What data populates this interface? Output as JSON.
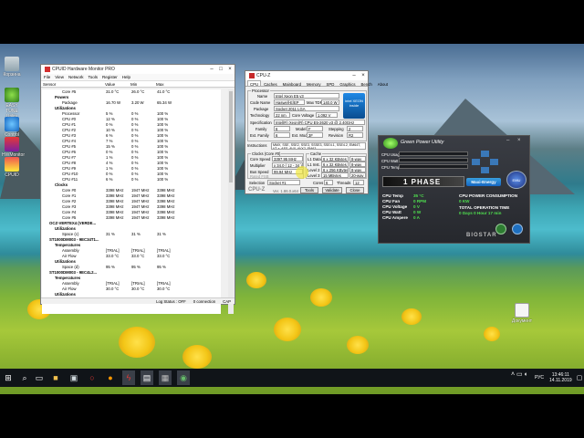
{
  "colors": {
    "accent_green": "#4fe04f",
    "taskbar": "#101418",
    "gpu_panel": "#2d3035",
    "intel_blue": "#0a6ab5"
  },
  "desktop_icons": [
    {
      "name": "desktop-icon-recycle",
      "label": "Корзина",
      "icon": "recycle-bin-icon"
    },
    {
      "name": "desktop-icon-easy-tune",
      "label": "EASY TUNE Utility",
      "icon": "easy-tune-icon"
    },
    {
      "name": "desktop-icon-control",
      "label": "Control Panel",
      "icon": "control-panel-icon"
    },
    {
      "name": "desktop-icon-hwmon",
      "label": "HWMonitor",
      "icon": "hwmonitor-icon"
    },
    {
      "name": "desktop-icon-cpuz",
      "label": "CPUID",
      "icon": "cpuz-icon"
    }
  ],
  "hwmonitor": {
    "title": "CPUID Hardware Monitor PRO",
    "menu": [
      "File",
      "View",
      "Network",
      "Tools",
      "Register",
      "Help"
    ],
    "columns": [
      "Sensor",
      "Value",
      "Min",
      "Max"
    ],
    "rows": [
      {
        "level": 3,
        "name": "Core #5",
        "value": "31.0 °C",
        "min": "26.0 °C",
        "max": "41.0 °C"
      },
      {
        "level": 2,
        "name": "Powers",
        "value": "",
        "min": "",
        "max": "",
        "group": true
      },
      {
        "level": 3,
        "name": "Package",
        "value": "16.70 W",
        "min": "3.20 W",
        "max": "65.34 W"
      },
      {
        "level": 2,
        "name": "Utilizations",
        "value": "",
        "min": "",
        "max": "",
        "group": true
      },
      {
        "level": 3,
        "name": "Processor",
        "value": "5 %",
        "min": "0 %",
        "max": "100 %"
      },
      {
        "level": 3,
        "name": "CPU #0",
        "value": "12 %",
        "min": "0 %",
        "max": "100 %"
      },
      {
        "level": 3,
        "name": "CPU #1",
        "value": "0 %",
        "min": "0 %",
        "max": "100 %"
      },
      {
        "level": 3,
        "name": "CPU #2",
        "value": "10 %",
        "min": "0 %",
        "max": "100 %"
      },
      {
        "level": 3,
        "name": "CPU #3",
        "value": "6 %",
        "min": "0 %",
        "max": "100 %"
      },
      {
        "level": 3,
        "name": "CPU #4",
        "value": "7 %",
        "min": "0 %",
        "max": "100 %"
      },
      {
        "level": 3,
        "name": "CPU #5",
        "value": "15 %",
        "min": "0 %",
        "max": "100 %"
      },
      {
        "level": 3,
        "name": "CPU #6",
        "value": "0 %",
        "min": "0 %",
        "max": "100 %"
      },
      {
        "level": 3,
        "name": "CPU #7",
        "value": "1 %",
        "min": "0 %",
        "max": "100 %"
      },
      {
        "level": 3,
        "name": "CPU #8",
        "value": "4 %",
        "min": "0 %",
        "max": "100 %"
      },
      {
        "level": 3,
        "name": "CPU #9",
        "value": "1 %",
        "min": "0 %",
        "max": "100 %"
      },
      {
        "level": 3,
        "name": "CPU #10",
        "value": "0 %",
        "min": "0 %",
        "max": "100 %"
      },
      {
        "level": 3,
        "name": "CPU #11",
        "value": "6 %",
        "min": "0 %",
        "max": "100 %"
      },
      {
        "level": 2,
        "name": "Clocks",
        "value": "",
        "min": "",
        "max": "",
        "group": true
      },
      {
        "level": 3,
        "name": "Core #0",
        "value": "3398 MHz",
        "min": "1947 MHz",
        "max": "3398 MHz"
      },
      {
        "level": 3,
        "name": "Core #1",
        "value": "3398 MHz",
        "min": "1947 MHz",
        "max": "3398 MHz"
      },
      {
        "level": 3,
        "name": "Core #2",
        "value": "3398 MHz",
        "min": "1947 MHz",
        "max": "3398 MHz"
      },
      {
        "level": 3,
        "name": "Core #3",
        "value": "3398 MHz",
        "min": "1947 MHz",
        "max": "3398 MHz"
      },
      {
        "level": 3,
        "name": "Core #4",
        "value": "3398 MHz",
        "min": "1947 MHz",
        "max": "3398 MHz"
      },
      {
        "level": 3,
        "name": "Core #5",
        "value": "3398 MHz",
        "min": "1947 MHz",
        "max": "3398 MHz"
      },
      {
        "level": 1,
        "name": "OCZ-VERTEX4 (VERDE...",
        "value": "",
        "min": "",
        "max": "",
        "group": true
      },
      {
        "level": 2,
        "name": "Utilizations",
        "value": "",
        "min": "",
        "max": "",
        "group": true
      },
      {
        "level": 3,
        "name": "Space (c)",
        "value": "31 %",
        "min": "31 %",
        "max": "31 %"
      },
      {
        "level": 1,
        "name": "ST1000DM003 - 9EC34T1...",
        "value": "",
        "min": "",
        "max": "",
        "group": true
      },
      {
        "level": 2,
        "name": "Temperatures",
        "value": "",
        "min": "",
        "max": "",
        "group": true
      },
      {
        "level": 3,
        "name": "Assembly",
        "value": "[TRIAL]",
        "min": "[TRIAL]",
        "max": "[TRIAL]"
      },
      {
        "level": 3,
        "name": "Air Flow",
        "value": "33.0 °C",
        "min": "33.0 °C",
        "max": "33.0 °C"
      },
      {
        "level": 2,
        "name": "Utilizations",
        "value": "",
        "min": "",
        "max": "",
        "group": true
      },
      {
        "level": 3,
        "name": "Space (d)",
        "value": "95 %",
        "min": "95 %",
        "max": "95 %"
      },
      {
        "level": 1,
        "name": "ST1000DM003 - 9EC4L2...",
        "value": "",
        "min": "",
        "max": "",
        "group": true
      },
      {
        "level": 2,
        "name": "Temperatures",
        "value": "",
        "min": "",
        "max": "",
        "group": true
      },
      {
        "level": 3,
        "name": "Assembly",
        "value": "[TRIAL]",
        "min": "[TRIAL]",
        "max": "[TRIAL]"
      },
      {
        "level": 3,
        "name": "Air Flow",
        "value": "30.0 °C",
        "min": "30.0 °C",
        "max": "30.0 °C"
      },
      {
        "level": 2,
        "name": "Utilizations",
        "value": "",
        "min": "",
        "max": "",
        "group": true
      },
      {
        "level": 3,
        "name": "Space (e)",
        "value": "84 %",
        "min": "84 %",
        "max": "84 %"
      }
    ],
    "status": {
      "log": "Log Status : OFF",
      "conn": "0 connection",
      "caps": "CAP"
    }
  },
  "cpuz": {
    "title": "CPU-Z",
    "tabs": [
      "CPU",
      "Caches",
      "Mainboard",
      "Memory",
      "SPD",
      "Graphics",
      "Bench",
      "About"
    ],
    "processor_legend": "Processor",
    "fields": {
      "name_l": "Name",
      "name": "Intel Xeon E5 v3",
      "code_l": "Code Name",
      "code": "Haswell-E/EP",
      "tdp_l": "Max TDP",
      "tdp": "140.0 W",
      "pkg_l": "Package",
      "pkg": "Socket 2011 LGA",
      "tech_l": "Technology",
      "tech": "22 nm",
      "volt_l": "Core Voltage",
      "volt": "1.092 V",
      "spec_l": "Specification",
      "spec": "Intel(R) Xeon(R) CPU E5-2620 v3 @ 2.40GHz",
      "fam_l": "Family",
      "fam": "6",
      "model_l": "Model",
      "model": "F",
      "step_l": "Stepping",
      "step": "2",
      "efam_l": "Ext. Family",
      "efam": "6",
      "emodel_l": "Ext. Model",
      "emodel": "3F",
      "rev_l": "Revision",
      "rev": "R2",
      "inst_l": "Instructions",
      "inst": "MMX, SSE, SSE2, SSE3, SSSE3, SSE4.1, SSE4.2, EM64T, VT-x, AES, AVX, AVX2, FMA3"
    },
    "clocks_legend": "Clocks (Core #0)",
    "cache_legend": "Cache",
    "clocks": {
      "speed_l": "Core Speed",
      "speed": "3397.95 MHz",
      "mult_l": "Multiplier",
      "mult": "x 34.0 ( 12 - 34 )",
      "bus_l": "Bus Speed",
      "bus": "99.94 MHz",
      "fsb_l": "Rated FSB",
      "fsb": ""
    },
    "cache": {
      "l1d_l": "L1 Data",
      "l1d": "6 x 32 KBytes",
      "l1d_w": "8-way",
      "l1i_l": "L1 Inst.",
      "l1i": "6 x 32 KBytes",
      "l1i_w": "8-way",
      "l2_l": "Level 2",
      "l2": "6 x 256 KBytes",
      "l2_w": "8-way",
      "l3_l": "Level 3",
      "l3": "15 MBytes",
      "l3_w": "20-way"
    },
    "selection_l": "Selection",
    "selection": "Socket #1",
    "cores_l": "Cores",
    "cores": "6",
    "threads_l": "Threads",
    "threads": "12",
    "footer": {
      "brand": "CPU-Z",
      "version": "Ver. 1.86.0.x64",
      "tools": "Tools",
      "validate": "Validate",
      "close": "Close"
    },
    "intel_badge": "intel XEON inside"
  },
  "gpu": {
    "title": "Green Power Utility",
    "labels": {
      "cpu_usage": "CPU Usage",
      "cpu_watt": "CPU Watt",
      "cpu_temp": "CPU Temp"
    },
    "phase": "1 PHASE",
    "mode": "Maxi-Energy",
    "stats": [
      {
        "label": "CPU Temp",
        "value": "35 °C"
      },
      {
        "label": "CPU Fan",
        "value": "0 RPM"
      },
      {
        "label": "CPU Voltage",
        "value": "0 V"
      },
      {
        "label": "CPU Watt",
        "value": "0 W"
      },
      {
        "label": "CPU Ampere",
        "value": "0 A"
      }
    ],
    "right_stats": [
      {
        "label": "CPU POWER CONSUMPTION",
        "value": "0 KW"
      },
      {
        "label": "TOTAL OPERATION TIME",
        "value": "0 Days 0 Hour 17 min"
      }
    ],
    "brand": "BIOSTAR",
    "emu": "EMU"
  },
  "taskbar": {
    "icons": [
      "start-icon",
      "search-icon",
      "task-view-icon",
      "file-explorer-icon",
      "store-icon",
      "opera-icon",
      "firefox-icon",
      "power-icon",
      "hwmonitor-icon",
      "cpuz-icon",
      "gpu-icon"
    ],
    "lang": "РУС",
    "time": "13:46:11",
    "date": "14.11.2019"
  },
  "desktop_file": {
    "label": "Документ"
  }
}
